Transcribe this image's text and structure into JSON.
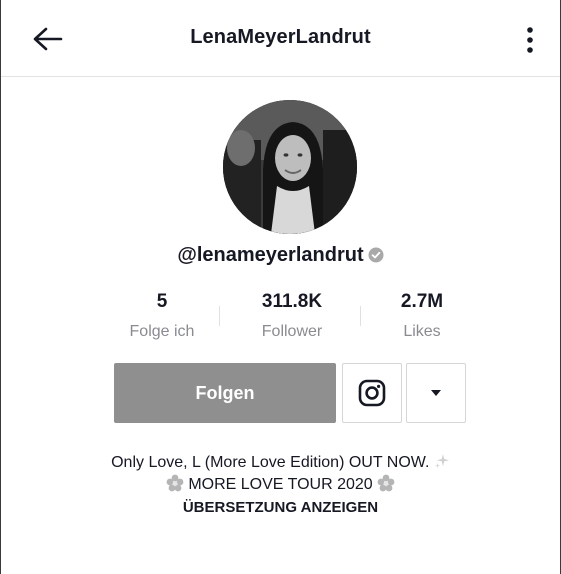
{
  "header": {
    "title": "LenaMeyerLandrut",
    "back_icon": "arrow-left-icon",
    "more_icon": "more-vertical-icon"
  },
  "profile": {
    "username": "@lenameyerlandrut",
    "verified_icon": "verified-badge-icon"
  },
  "stats": [
    {
      "value": "5",
      "label": "Folge ich"
    },
    {
      "value": "311.8K",
      "label": "Follower"
    },
    {
      "value": "2.7M",
      "label": "Likes"
    }
  ],
  "actions": {
    "follow_label": "Folgen",
    "instagram_icon": "instagram-icon",
    "dropdown_icon": "caret-down-icon"
  },
  "bio": {
    "line1": "Only Love, L (More Love Edition) OUT NOW.",
    "line2": "MORE LOVE TOUR 2020",
    "translate_label": "ÜBERSETZUNG ANZEIGEN"
  },
  "colors": {
    "follow_button_bg": "#8f8f8f",
    "secondary_text": "#8a8b91",
    "primary_text": "#161823"
  }
}
